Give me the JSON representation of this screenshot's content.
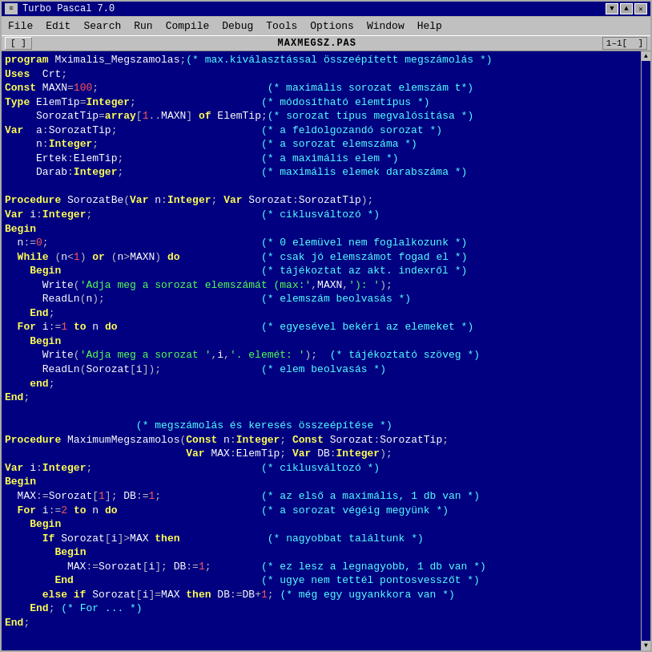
{
  "window": {
    "title": "Turbo Pascal 7.0",
    "filename": "MAXMEGSZ.PAS",
    "line_col": "1–1[  ]"
  },
  "menu": {
    "items": [
      "File",
      "Edit",
      "Search",
      "Run",
      "Compile",
      "Debug",
      "Tools",
      "Options",
      "Window",
      "Help"
    ]
  },
  "toolbar": {
    "buttons": [
      "[ ]"
    ],
    "filename": "MAXMEGSZ.PAS",
    "line_info": "1-1[  ]"
  },
  "code_lines": [
    {
      "id": 1,
      "text": "program Mximalis_Megszamolas;(* max.kiválasztással összeépített megszámolás *)"
    },
    {
      "id": 2,
      "text": "Uses  Crt;"
    },
    {
      "id": 3,
      "text": "Const MAXN=100;                           (* maximális sorozat elemszám t*)"
    },
    {
      "id": 4,
      "text": "Type ElemTip=Integer;                    (* módosítható elemtípus *)"
    },
    {
      "id": 5,
      "text": "     SorozatTip=array[1..MAXN] of ElemTip;(* sorozat típus megvalósítása *)"
    },
    {
      "id": 6,
      "text": "Var  a:SorozatTip;                       (* a feldolgozandó sorozat *)"
    },
    {
      "id": 7,
      "text": "     n:Integer;                          (* a sorozat elemszáma *)"
    },
    {
      "id": 8,
      "text": "     Ertek:ElemTip;                      (* a maximális elem *)"
    },
    {
      "id": 9,
      "text": "     Darab:Integer;                      (* maximális elemek darabszáma *)"
    },
    {
      "id": 10,
      "text": ""
    },
    {
      "id": 11,
      "text": "Procedure SorozatBe(Var n:Integer; Var Sorozat:SorozatTip);"
    },
    {
      "id": 12,
      "text": "Var i:Integer;                           (* ciklusváltozó *)"
    },
    {
      "id": 13,
      "text": "Begin"
    },
    {
      "id": 14,
      "text": "  n:=0;                                  (* 0 elemüvel nem foglalkozunk *)"
    },
    {
      "id": 15,
      "text": "  While (n<1) or (n>MAXN) do             (* csak jó elemszámot fogad el *)"
    },
    {
      "id": 16,
      "text": "    Begin                                (* tájékoztat az akt. indexről *)"
    },
    {
      "id": 17,
      "text": "      Write('Adja meg a sorozat elemszámát (max:',MAXN,'): ');"
    },
    {
      "id": 18,
      "text": "      ReadLn(n);                         (* elemszám beolvasás *)"
    },
    {
      "id": 19,
      "text": "    End;"
    },
    {
      "id": 20,
      "text": "  For i:=1 to n do                       (* egyesével bekéri az elemeket *)"
    },
    {
      "id": 21,
      "text": "    Begin"
    },
    {
      "id": 22,
      "text": "      Write('Adja meg a sorozat ',i,'. elemét: ');  (* tájékoztató szöveg *)"
    },
    {
      "id": 23,
      "text": "      ReadLn(Sorozat[i]);                (* elem beolvasás *)"
    },
    {
      "id": 24,
      "text": "    end;"
    },
    {
      "id": 25,
      "text": "End;"
    },
    {
      "id": 26,
      "text": ""
    },
    {
      "id": 27,
      "text": "                     (* megszámolás és keresés összeépítése *)"
    },
    {
      "id": 28,
      "text": "Procedure MaximumMegszamolos(Const n:Integer; Const Sorozat:SorozatTip;"
    },
    {
      "id": 29,
      "text": "                             Var MAX:ElemTip; Var DB:Integer);"
    },
    {
      "id": 30,
      "text": "Var i:Integer;                           (* ciklusváltozó *)"
    },
    {
      "id": 31,
      "text": "Begin"
    },
    {
      "id": 32,
      "text": "  MAX:=Sorozat[1]; DB:=1;                (* az első a maximális, 1 db van *)"
    },
    {
      "id": 33,
      "text": "  For i:=2 to n do                       (* a sorozat végéig megyünk *)"
    },
    {
      "id": 34,
      "text": "    Begin"
    },
    {
      "id": 35,
      "text": "      If Sorozat[i]>MAX then              (* nagyobbat találtunk *)"
    },
    {
      "id": 36,
      "text": "        Begin"
    },
    {
      "id": 37,
      "text": "          MAX:=Sorozat[i]; DB:=1;        (* ez lesz a legnagyobb, 1 db van *)"
    },
    {
      "id": 38,
      "text": "        End                              (* ugye nem tettél pontosvesszőt *)"
    },
    {
      "id": 39,
      "text": "      else if Sorozat[i]=MAX then DB:=DB+1; (* még egy ugyankkora van *)"
    },
    {
      "id": 40,
      "text": "    End; (* For ... *)"
    },
    {
      "id": 41,
      "text": "End;"
    }
  ]
}
